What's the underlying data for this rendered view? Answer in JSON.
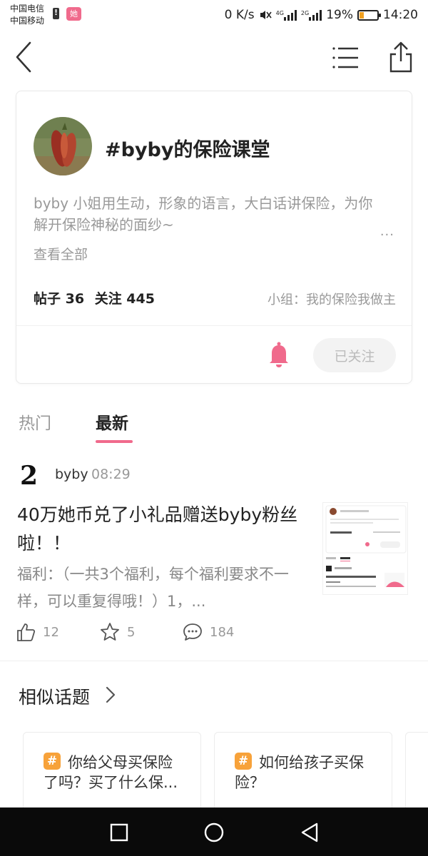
{
  "status_bar": {
    "carrier_1": "中国电信",
    "carrier_2": "中国移动",
    "app_badge": "她",
    "network_speed": "0 K/s",
    "sig1_label": "4G",
    "sig2_label": "2G",
    "battery_percent": "19%",
    "time": "14:20",
    "battery_level": 0.19
  },
  "topic": {
    "title": "#byby的保险课堂",
    "description": "byby 小姐用生动，形象的语言，大白话讲保险，为你解开保险神秘的面纱~",
    "more_dots": "...",
    "see_all": "查看全部",
    "posts_label": "帖子 36",
    "follows_label": "关注 445",
    "group_label": "小组：我的保险我做主",
    "follow_button": "已关注"
  },
  "tabs": {
    "hot": "热门",
    "latest": "最新",
    "active": "latest"
  },
  "post": {
    "avatar_glyph": "2",
    "author": "byby",
    "time": "08:29",
    "title": "40万她币兑了小礼品赠送byby粉丝啦！！",
    "excerpt": "福利：（一共3个福利，每个福利要求不一样，可以重复得哦！）1，...",
    "likes": "12",
    "favorites": "5",
    "comments": "184"
  },
  "similar": {
    "title": "相似话题",
    "badge": "#",
    "items": [
      {
        "text": "你给父母买保险了吗？买了什么保..."
      },
      {
        "text": "如何给孩子买保险？"
      }
    ]
  },
  "colors": {
    "accent_pink": "#f06a8c",
    "hash_orange": "#f7a23a",
    "muted_text": "#999999"
  }
}
